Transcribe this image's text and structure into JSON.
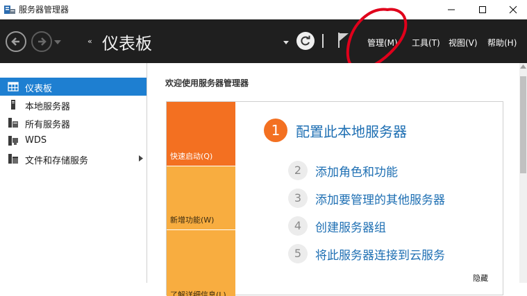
{
  "window": {
    "title": "服务器管理器",
    "controls": [
      "minimize-icon",
      "maximize-icon",
      "close-icon"
    ]
  },
  "toolbar": {
    "breadcrumb_arrows": "‹‹",
    "page_title": "仪表板",
    "menu": {
      "manage": "管理(M)",
      "tools": "工具(T)",
      "view": "视图(V)",
      "help": "帮助(H)"
    },
    "icons": [
      "back-icon",
      "forward-icon",
      "refresh-icon",
      "flag-icon"
    ]
  },
  "sidebar": {
    "items": [
      {
        "label": "仪表板",
        "icon": "dashboard-icon",
        "active": true
      },
      {
        "label": "本地服务器",
        "icon": "server-icon",
        "active": false
      },
      {
        "label": "所有服务器",
        "icon": "servers-icon",
        "active": false
      },
      {
        "label": "WDS",
        "icon": "wds-icon",
        "active": false
      },
      {
        "label": "文件和存储服务",
        "icon": "storage-icon",
        "active": false,
        "expandable": true
      }
    ]
  },
  "main": {
    "welcome": "欢迎使用服务器管理器",
    "tiles": {
      "quick_start": "快速启动(Q)",
      "whats_new": "新增功能(W)",
      "learn_more": "了解详细信息(L)"
    },
    "steps": [
      {
        "num": "1",
        "label": "配置此本地服务器"
      },
      {
        "num": "2",
        "label": "添加角色和功能"
      },
      {
        "num": "3",
        "label": "添加要管理的其他服务器"
      },
      {
        "num": "4",
        "label": "创建服务器组"
      },
      {
        "num": "5",
        "label": "将此服务器连接到云服务"
      }
    ],
    "hide": "隐藏"
  },
  "colors": {
    "command_bar": "#1f1f1f",
    "sidebar_active": "#1e7fd1",
    "quick_start_tile": "#f37021",
    "secondary_tiles": "#f8ad40",
    "link_blue": "#1e6fb3",
    "annotation_red": "#e0001b"
  }
}
